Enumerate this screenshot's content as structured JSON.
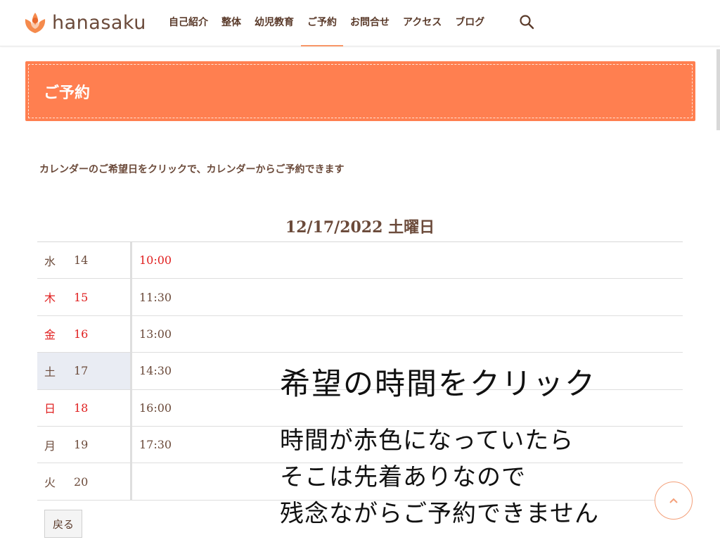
{
  "site": {
    "name": "hanasaku",
    "brand_color": "#ff7f50",
    "accent_red": "#e02020"
  },
  "nav": {
    "items": [
      {
        "label": "自己紹介"
      },
      {
        "label": "整体"
      },
      {
        "label": "幼児教育"
      },
      {
        "label": "ご予約",
        "active": true
      },
      {
        "label": "お問合せ"
      },
      {
        "label": "アクセス"
      },
      {
        "label": "ブログ"
      }
    ],
    "search_icon": "search-icon"
  },
  "banner": {
    "title": "ご予約"
  },
  "instruction": "カレンダーのご希望日をクリックで、カレンダーからご予約できます",
  "schedule": {
    "date_heading": "12/17/2022 土曜日",
    "rows": [
      {
        "weekday": "水",
        "day": "14",
        "time": "10:00"
      },
      {
        "weekday": "木",
        "day": "15",
        "time": "11:30"
      },
      {
        "weekday": "金",
        "day": "16",
        "time": "13:00"
      },
      {
        "weekday": "土",
        "day": "17",
        "time": "14:30"
      },
      {
        "weekday": "日",
        "day": "18",
        "time": "16:00"
      },
      {
        "weekday": "月",
        "day": "19",
        "time": "17:30"
      },
      {
        "weekday": "火",
        "day": "20",
        "time": ""
      }
    ]
  },
  "back_button": "戻る",
  "overlay": {
    "headline": "希望の時間をクリック",
    "lines": [
      "時間が赤色になっていたら",
      "そこは先着ありなので",
      "残念ながらご予約できません"
    ]
  },
  "scroll_top_icon": "chevron-up-icon"
}
